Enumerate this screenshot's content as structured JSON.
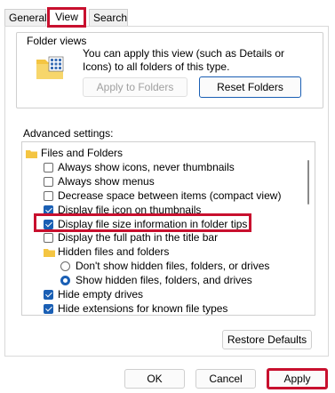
{
  "tabs": [
    {
      "label": "General"
    },
    {
      "label": "View"
    },
    {
      "label": "Search"
    }
  ],
  "folder_views": {
    "title": "Folder views",
    "description": "You can apply this view (such as Details or Icons) to all folders of this type.",
    "apply_label": "Apply to Folders",
    "reset_label": "Reset Folders"
  },
  "advanced": {
    "title": "Advanced settings:",
    "items": [
      {
        "type": "folder",
        "label": "Files and Folders"
      },
      {
        "type": "checkbox",
        "checked": false,
        "label": "Always show icons, never thumbnails"
      },
      {
        "type": "checkbox",
        "checked": false,
        "label": "Always show menus"
      },
      {
        "type": "checkbox",
        "checked": false,
        "label": "Decrease space between items (compact view)"
      },
      {
        "type": "checkbox",
        "checked": true,
        "label": "Display file icon on thumbnails"
      },
      {
        "type": "checkbox",
        "checked": true,
        "label": "Display file size information in folder tips"
      },
      {
        "type": "checkbox",
        "checked": false,
        "label": "Display the full path in the title bar"
      },
      {
        "type": "folder",
        "label": "Hidden files and folders"
      },
      {
        "type": "radio",
        "checked": false,
        "label": "Don't show hidden files, folders, or drives"
      },
      {
        "type": "radio",
        "checked": true,
        "label": "Show hidden files, folders, and drives"
      },
      {
        "type": "checkbox",
        "checked": true,
        "label": "Hide empty drives"
      },
      {
        "type": "checkbox",
        "checked": true,
        "label": "Hide extensions for known file types"
      }
    ],
    "restore_label": "Restore Defaults"
  },
  "footer": {
    "ok_label": "OK",
    "cancel_label": "Cancel",
    "apply_label": "Apply"
  },
  "colors": {
    "accent": "#1a5fb4",
    "highlight": "#c8102e",
    "folder": "#f4c542"
  }
}
